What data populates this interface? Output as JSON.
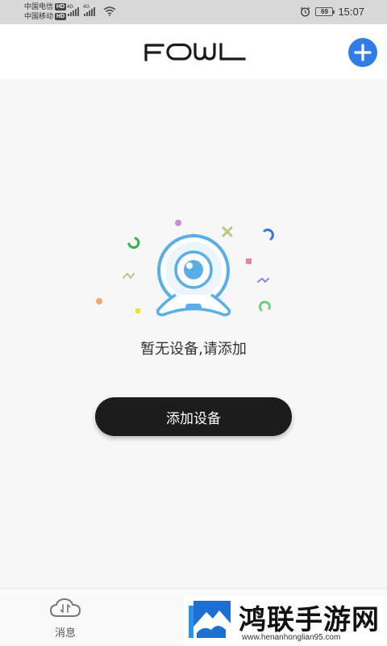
{
  "status_bar": {
    "carrier1": "中国电信",
    "carrier2": "中国移动",
    "hd_label": "HD",
    "network_label": "4G",
    "battery": "69",
    "time": "15:07"
  },
  "header": {
    "logo_text": "FOWL",
    "add_button_icon": "plus-icon"
  },
  "empty_state": {
    "illustration_icon": "webcam-icon",
    "message": "暂无设备,请添加"
  },
  "actions": {
    "add_device_label": "添加设备"
  },
  "bottom_nav": {
    "items": [
      {
        "icon": "cloud-icon",
        "label": "消息"
      }
    ]
  },
  "watermark": {
    "title": "鸿联手游网",
    "url": "www.henanhonglian95.com"
  },
  "colors": {
    "accent_blue": "#2f7ee6",
    "camera_blue": "#5aaee8",
    "button_dark": "#1c1c1c",
    "background": "#f7f7f7"
  }
}
